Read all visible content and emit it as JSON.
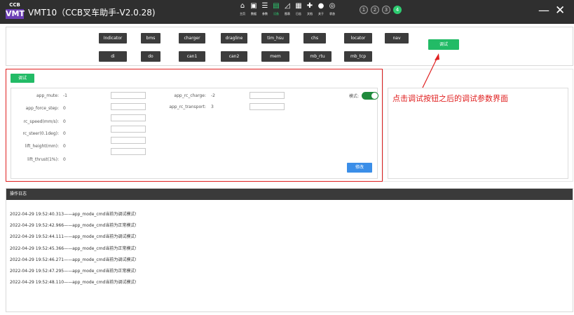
{
  "titlebar": {
    "logo_top": "CCB",
    "logo_bottom": "VMT",
    "title": "VMT10（CCB叉车助手-V2.0.28)",
    "nav": [
      {
        "label": "主页",
        "icon": "home-icon",
        "glyph": "⌂"
      },
      {
        "label": "数据",
        "icon": "monitor-icon",
        "glyph": "▣"
      },
      {
        "label": "参数",
        "icon": "sliders-icon",
        "glyph": "☰"
      },
      {
        "label": "设备",
        "icon": "device-icon",
        "glyph": "▤"
      },
      {
        "label": "图表",
        "icon": "chart-icon",
        "glyph": "◿"
      },
      {
        "label": "日志",
        "icon": "log-icon",
        "glyph": "▦"
      },
      {
        "label": "文档",
        "icon": "document-icon",
        "glyph": "✚"
      },
      {
        "label": "关于",
        "icon": "info-icon",
        "glyph": "●"
      },
      {
        "label": "状态",
        "icon": "status-icon",
        "glyph": "◎"
      }
    ],
    "active_nav": 3,
    "steps": [
      "1",
      "2",
      "3",
      "4"
    ],
    "active_step": 3,
    "minimize": "—",
    "close": "✕"
  },
  "modules": {
    "row1": [
      "Indicator",
      "bms",
      "charger",
      "dragline",
      "tim_hsu",
      "chs",
      "locator",
      "nav"
    ],
    "row2": [
      "di",
      "do",
      "can1",
      "can2",
      "mem",
      "mb_rtu",
      "mb_tcp"
    ],
    "debug_button": "调试"
  },
  "debug_panel": {
    "debug_button": "调试",
    "params_left": [
      {
        "label": "app_mute:",
        "value": "-1"
      },
      {
        "label": "app_force_step:",
        "value": "0"
      },
      {
        "label": "rc_speed(mm/s):",
        "value": "0"
      },
      {
        "label": "rc_steer(0.1deg):",
        "value": "0"
      },
      {
        "label": "lift_height(mm):",
        "value": "0"
      },
      {
        "label": "lift_thrust(1%):",
        "value": "0"
      }
    ],
    "params_right": [
      {
        "label": "app_rc_charge:",
        "value": "-2"
      },
      {
        "label": "app_rc_transport:",
        "value": "3"
      }
    ],
    "mode_label": "模式:",
    "modify_button": "修改"
  },
  "annotation": "点击调试按钮之后的调试参数界面",
  "log": {
    "header": "操作日志",
    "lines": [
      "2022-04-29 19:52:40.313——app_mode_cmd当前为调试模式!",
      "2022-04-29 19:52:42.966——app_mode_cmd当前为正常模式!",
      "2022-04-29 19:52:44.111——app_mode_cmd当前为调试模式!",
      "2022-04-29 19:52:45.366——app_mode_cmd当前为正常模式!",
      "2022-04-29 19:52:46.271——app_mode_cmd当前为调试模式!",
      "2022-04-29 19:52:47.295——app_mode_cmd当前为正常模式!",
      "2022-04-29 19:52:48.110——app_mode_cmd当前为调试模式!"
    ]
  },
  "colors": {
    "titlebar": "#2f2f2f",
    "accent_green": "#22bb66",
    "chip": "#3c3c3c",
    "modify_blue": "#3b8ee8",
    "annotation_red": "#e02020"
  }
}
